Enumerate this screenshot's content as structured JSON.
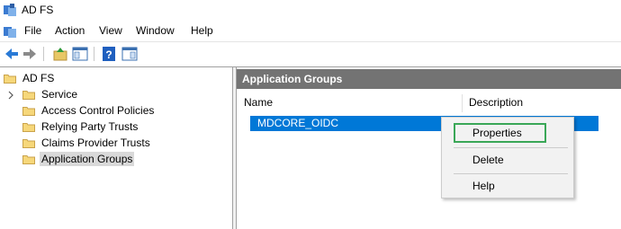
{
  "window": {
    "title": "AD FS"
  },
  "menubar": {
    "items": [
      "File",
      "Action",
      "View",
      "Window",
      "Help"
    ]
  },
  "tree": {
    "root": "AD FS",
    "items": [
      "Service",
      "Access Control Policies",
      "Relying Party Trusts",
      "Claims Provider Trusts",
      "Application Groups"
    ],
    "selected": "Application Groups"
  },
  "pane": {
    "title": "Application Groups",
    "columns": [
      "Name",
      "Description"
    ],
    "rows": [
      {
        "name": "MDCORE_OIDC",
        "description": ""
      }
    ]
  },
  "context_menu": {
    "items": [
      "Properties",
      "Delete",
      "Help"
    ],
    "highlighted": "Properties"
  },
  "colors": {
    "selection": "#0078d7",
    "header": "#737373",
    "highlight_box": "#3aa757"
  }
}
